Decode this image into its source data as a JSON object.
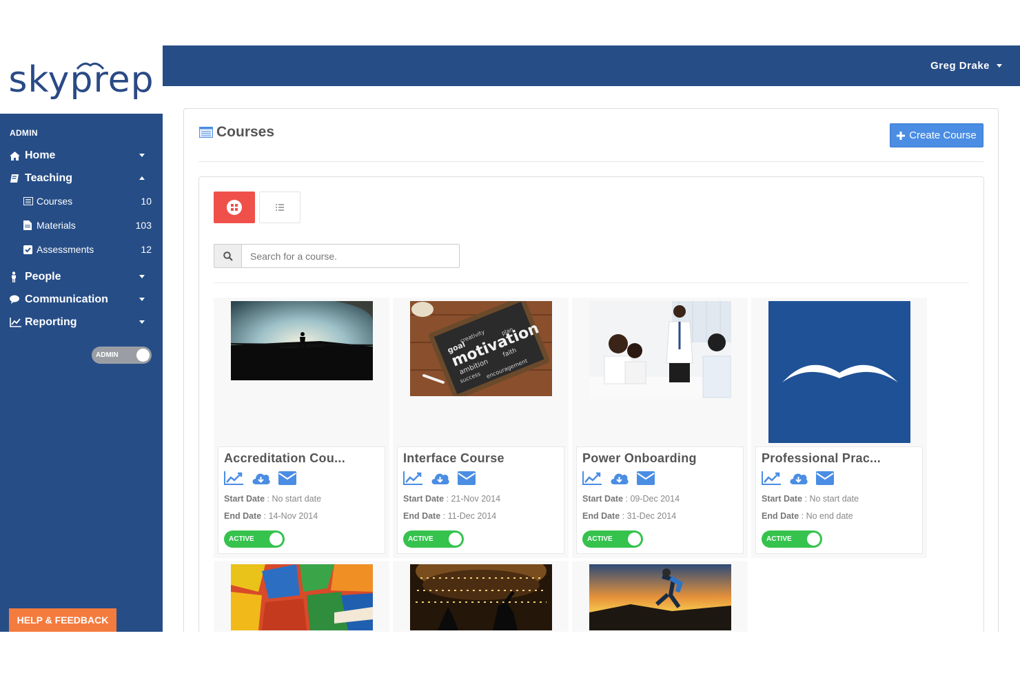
{
  "brand": {
    "logo_text_a": "sky",
    "logo_text_b": "prep",
    "color": "#264d86"
  },
  "header": {
    "user_name": "Greg Drake"
  },
  "sidebar": {
    "section_label": "ADMIN",
    "items": [
      {
        "label": "Home",
        "icon": "home-icon"
      },
      {
        "label": "Teaching",
        "icon": "book-icon",
        "expanded": true
      },
      {
        "label": "People",
        "icon": "person-icon"
      },
      {
        "label": "Communication",
        "icon": "chat-icon"
      },
      {
        "label": "Reporting",
        "icon": "chart-icon"
      }
    ],
    "sub_items": [
      {
        "label": "Courses",
        "count": "10",
        "icon": "list-icon"
      },
      {
        "label": "Materials",
        "count": "103",
        "icon": "file-icon"
      },
      {
        "label": "Assessments",
        "count": "12",
        "icon": "checkbox-icon"
      }
    ],
    "admin_toggle_label": "ADMIN",
    "help_label": "HELP & FEEDBACK"
  },
  "main": {
    "title": "Courses",
    "create_button": "Create Course",
    "search_placeholder": "Search for a course.",
    "courses": [
      {
        "title": "Accreditation Cou...",
        "start_label": "Start Date",
        "start_value": " : No start date",
        "end_label": "End Date",
        "end_value": " : 14-Nov 2014",
        "status": "ACTIVE"
      },
      {
        "title": "Interface Course",
        "start_label": "Start Date",
        "start_value": " : 21-Nov 2014",
        "end_label": "End Date",
        "end_value": " : 11-Dec 2014",
        "status": "ACTIVE"
      },
      {
        "title": "Power Onboarding",
        "start_label": "Start Date",
        "start_value": " : 09-Dec 2014",
        "end_label": "End Date",
        "end_value": " : 31-Dec 2014",
        "status": "ACTIVE"
      },
      {
        "title": "Professional Prac...",
        "start_label": "Start Date",
        "start_value": " : No start date",
        "end_label": "End Date",
        "end_value": " : No end date",
        "status": "ACTIVE"
      }
    ],
    "chalkboard_words": [
      "motivation",
      "goal",
      "ambition",
      "success",
      "encouragement",
      "plan",
      "faith",
      "creativity"
    ]
  },
  "colors": {
    "accent_red": "#f0504a",
    "accent_blue": "#4a8de3",
    "active_green": "#35c24d",
    "help_orange": "#f47b3e"
  }
}
